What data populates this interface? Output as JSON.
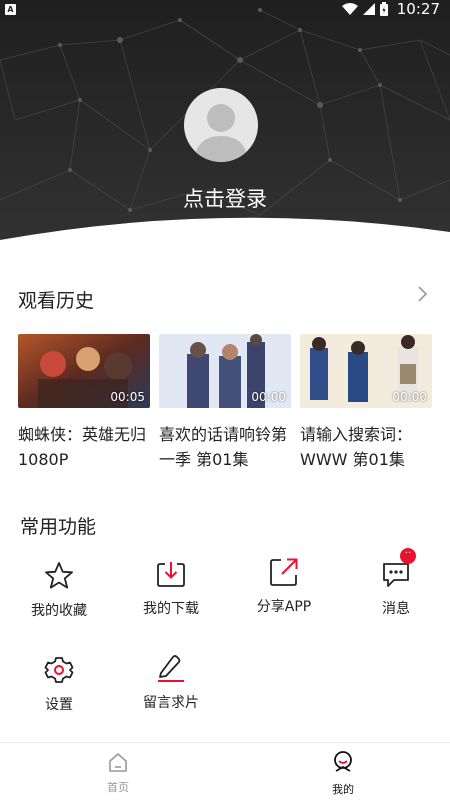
{
  "status_bar": {
    "badge": "A",
    "time": "10:27",
    "icons": [
      "wifi-icon",
      "signal-icon",
      "battery-icon"
    ]
  },
  "header": {
    "avatar_icon": "user-avatar-icon",
    "login_label": "点击登录"
  },
  "history": {
    "title": "观看历史",
    "more_icon": "chevron-right-icon",
    "items": [
      {
        "title": "蜘蛛侠：英雄无归 1080P",
        "duration": "00:05"
      },
      {
        "title": "喜欢的话请响铃第一季 第01集",
        "duration": "00:00"
      },
      {
        "title": "请输入搜索词：WWW 第01集",
        "duration": "00:00"
      }
    ]
  },
  "functions": {
    "title": "常用功能",
    "items": [
      {
        "label": "我的收藏",
        "icon": "star-icon"
      },
      {
        "label": "我的下载",
        "icon": "download-icon"
      },
      {
        "label": "分享APP",
        "icon": "share-icon"
      },
      {
        "label": "消息",
        "icon": "message-icon",
        "badge": "··"
      },
      {
        "label": "设置",
        "icon": "gear-icon"
      },
      {
        "label": "留言求片",
        "icon": "edit-icon"
      }
    ]
  },
  "nav": {
    "items": [
      {
        "label": "首页",
        "icon": "home-icon",
        "active": false
      },
      {
        "label": "我的",
        "icon": "profile-icon",
        "active": true
      }
    ]
  },
  "colors": {
    "accent": "#e8132f",
    "header_bg": "#262626",
    "text": "#222222",
    "inactive": "#999999"
  }
}
